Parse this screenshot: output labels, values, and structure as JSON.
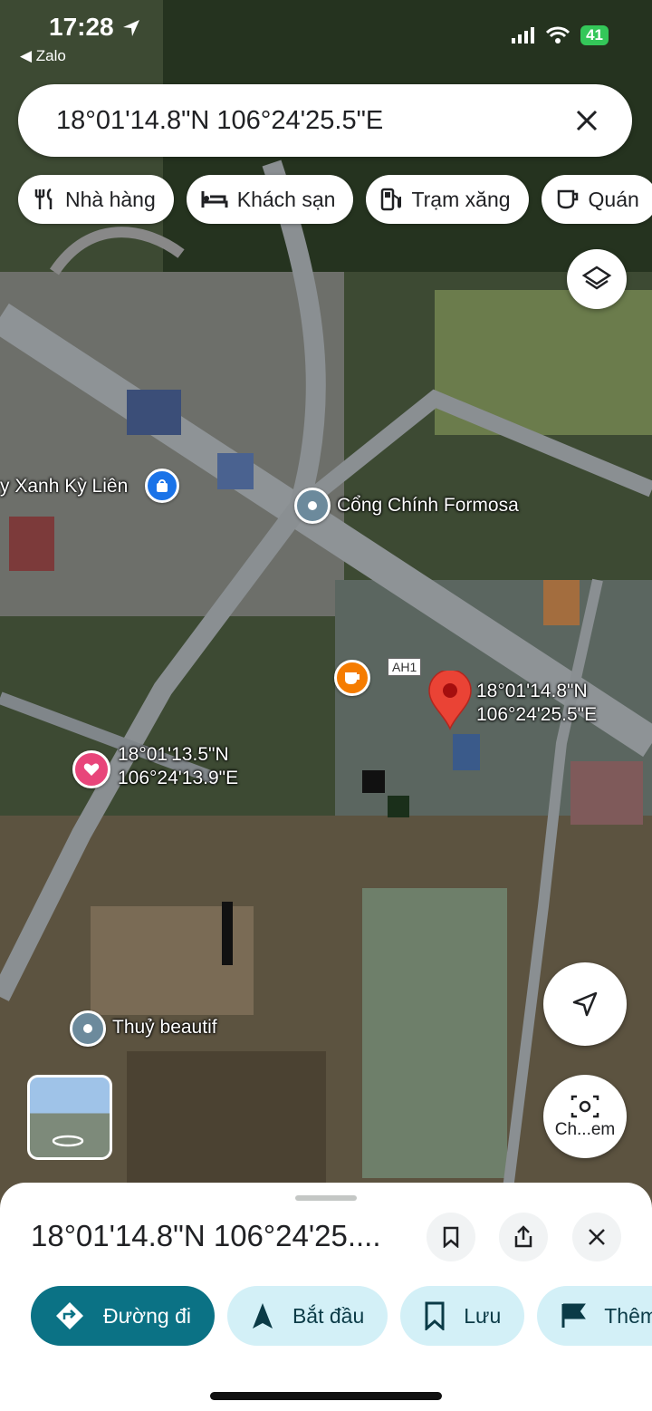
{
  "status_bar": {
    "time": "17:28",
    "back_app": "◀ Zalo",
    "battery": "41"
  },
  "search": {
    "value": "18°01'14.8\"N 106°24'25.5\"E"
  },
  "chips": [
    {
      "label": "Nhà hàng",
      "icon": "restaurant-icon"
    },
    {
      "label": "Khách sạn",
      "icon": "hotel-icon"
    },
    {
      "label": "Trạm xăng",
      "icon": "gas-station-icon"
    },
    {
      "label": "Quán",
      "icon": "cafe-icon"
    }
  ],
  "map": {
    "labels": {
      "store": "y Xanh Kỳ Liên",
      "gate": "Cổng Chính Formosa",
      "road_shield": "AH1",
      "pin_lat": "18°01'14.8\"N",
      "pin_lng": "106°24'25.5\"E",
      "saved_lat": "18°01'13.5\"N",
      "saved_lng": "106°24'13.9\"E",
      "beauty": "Thuỷ beautif"
    },
    "camera_label": "Ch...em"
  },
  "sheet": {
    "title": "18°01'14.8\"N 106°24'25....",
    "actions": [
      {
        "label": "Đường đi",
        "icon": "directions-icon"
      },
      {
        "label": "Bắt đầu",
        "icon": "navigation-icon"
      },
      {
        "label": "Lưu",
        "icon": "bookmark-icon"
      },
      {
        "label": "Thêm",
        "icon": "flag-icon"
      }
    ]
  },
  "colors": {
    "primary_action": "#0b7285",
    "secondary_action": "#d3f0f7",
    "pin": "#ea4335",
    "battery": "#34c759"
  }
}
